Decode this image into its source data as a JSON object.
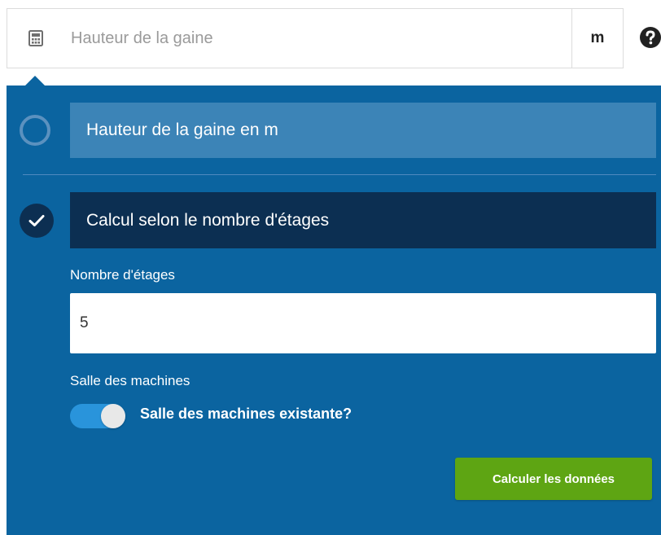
{
  "height_field": {
    "placeholder": "Hauteur de la gaine",
    "unit": "m",
    "icon": "calculator-icon"
  },
  "help": {
    "icon": "question-circle-icon"
  },
  "options": [
    {
      "label": "Hauteur de la gaine en m",
      "selected": false
    },
    {
      "label": "Calcul selon le nombre d'étages",
      "selected": true
    }
  ],
  "floors": {
    "label": "Nombre d'étages",
    "value": "5"
  },
  "machine_room": {
    "label": "Salle des machines",
    "toggle_label": "Salle des machines existante?",
    "toggle_on": true
  },
  "actions": {
    "calculate_label": "Calculer les données"
  },
  "colors": {
    "panel": "#0b64a0",
    "option_inactive": "#3c84b7",
    "option_active": "#0c2f52",
    "button": "#5ea513",
    "toggle": "#2994db"
  }
}
